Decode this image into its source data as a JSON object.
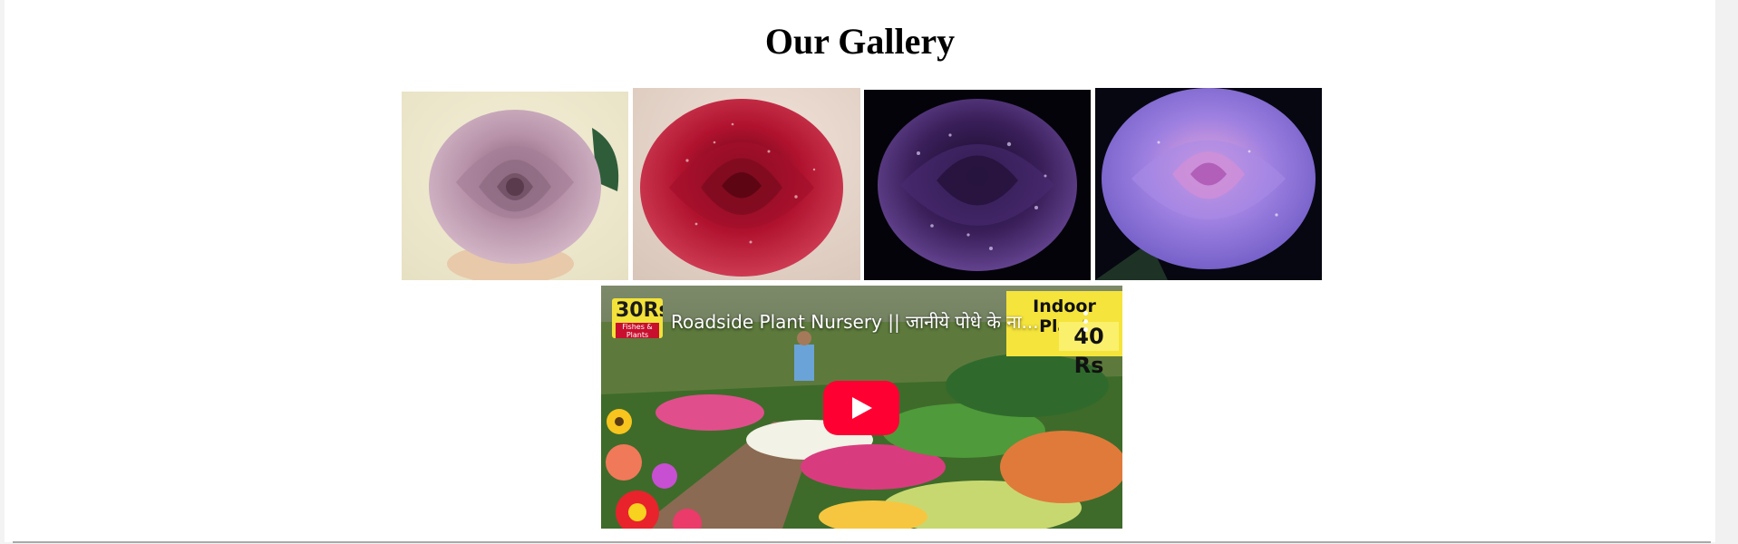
{
  "gallery": {
    "title": "Our Gallery",
    "images": [
      {
        "name": "dusty-lilac-rose",
        "color": "#b98fa8"
      },
      {
        "name": "red-rose-with-dew",
        "color": "#b0122e"
      },
      {
        "name": "dark-purple-rose-with-dew",
        "color": "#3a1f5a"
      },
      {
        "name": "lavender-rose",
        "color": "#9c7fe0"
      }
    ]
  },
  "video": {
    "title": "Roadside Plant Nursery || जानीये पोधे के ना...",
    "channel_logo_big": "30Rs",
    "channel_logo_small": "Fishes & Plants",
    "badge_line1": "Indoor Plant",
    "badge_line2": "40 Rs",
    "play_icon": "youtube-play-icon",
    "menu_icon": "more-vertical-icon"
  }
}
